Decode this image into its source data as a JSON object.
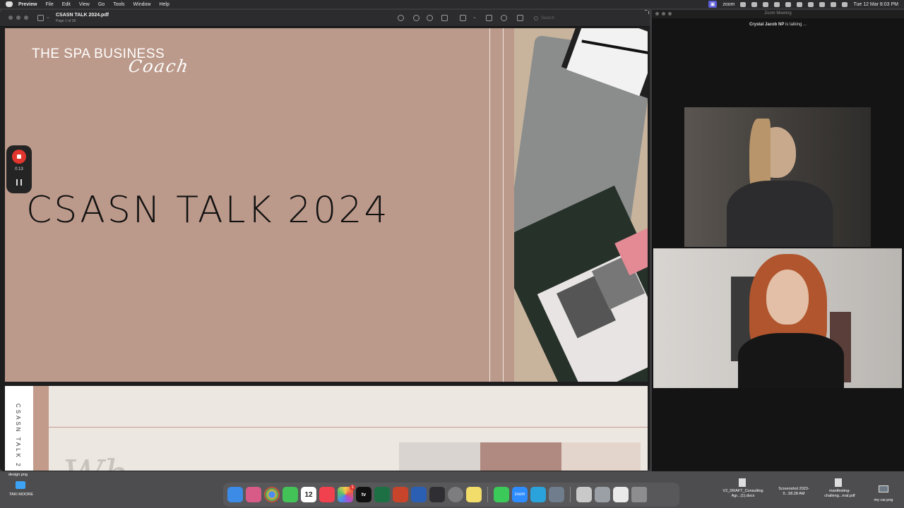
{
  "menubar": {
    "app": "Preview",
    "items": [
      "File",
      "Edit",
      "View",
      "Go",
      "Tools",
      "Window",
      "Help"
    ],
    "zoom_label": "zoom",
    "clock": "Tue 12 Mar  8:03 PM"
  },
  "preview": {
    "doc_title": "CSASN TALK 2024.pdf",
    "doc_subtitle": "Page 1 of 36",
    "search_placeholder": "Search"
  },
  "slide1": {
    "brand_line1": "THE SPA BUSINESS",
    "brand_line2": "Coach",
    "title": "CSASN TALK 2024"
  },
  "recorder": {
    "time": "0:13"
  },
  "slide2": {
    "side_text": "CSASN TALK 2",
    "script_text": "Wh"
  },
  "zoom": {
    "window_title": "Zoom Meeting",
    "talking_name": "Crystal Jacob NP",
    "talking_suffix": " is talking ..."
  },
  "desktop": {
    "files": [
      {
        "name": "design.png"
      },
      {
        "name": "TAKI MOORE"
      },
      {
        "name": "V2_DRAFT_Consulting Agr...(1).docx"
      },
      {
        "name": "Screenshot 2023-0...58.28 AM"
      },
      {
        "name": "manifesting-challeng...rnal.pdf"
      },
      {
        "name": "my car.png"
      }
    ]
  },
  "dock": {
    "calendar_month": "MAR",
    "calendar_day": "12",
    "tv_label": "tv",
    "zoom_label": "zoom",
    "photos_badge": "1"
  },
  "colors": {
    "slide_pink": "#bc9a8b",
    "record_red": "#e2352d",
    "zoom_badge": "#5b5bd6"
  }
}
